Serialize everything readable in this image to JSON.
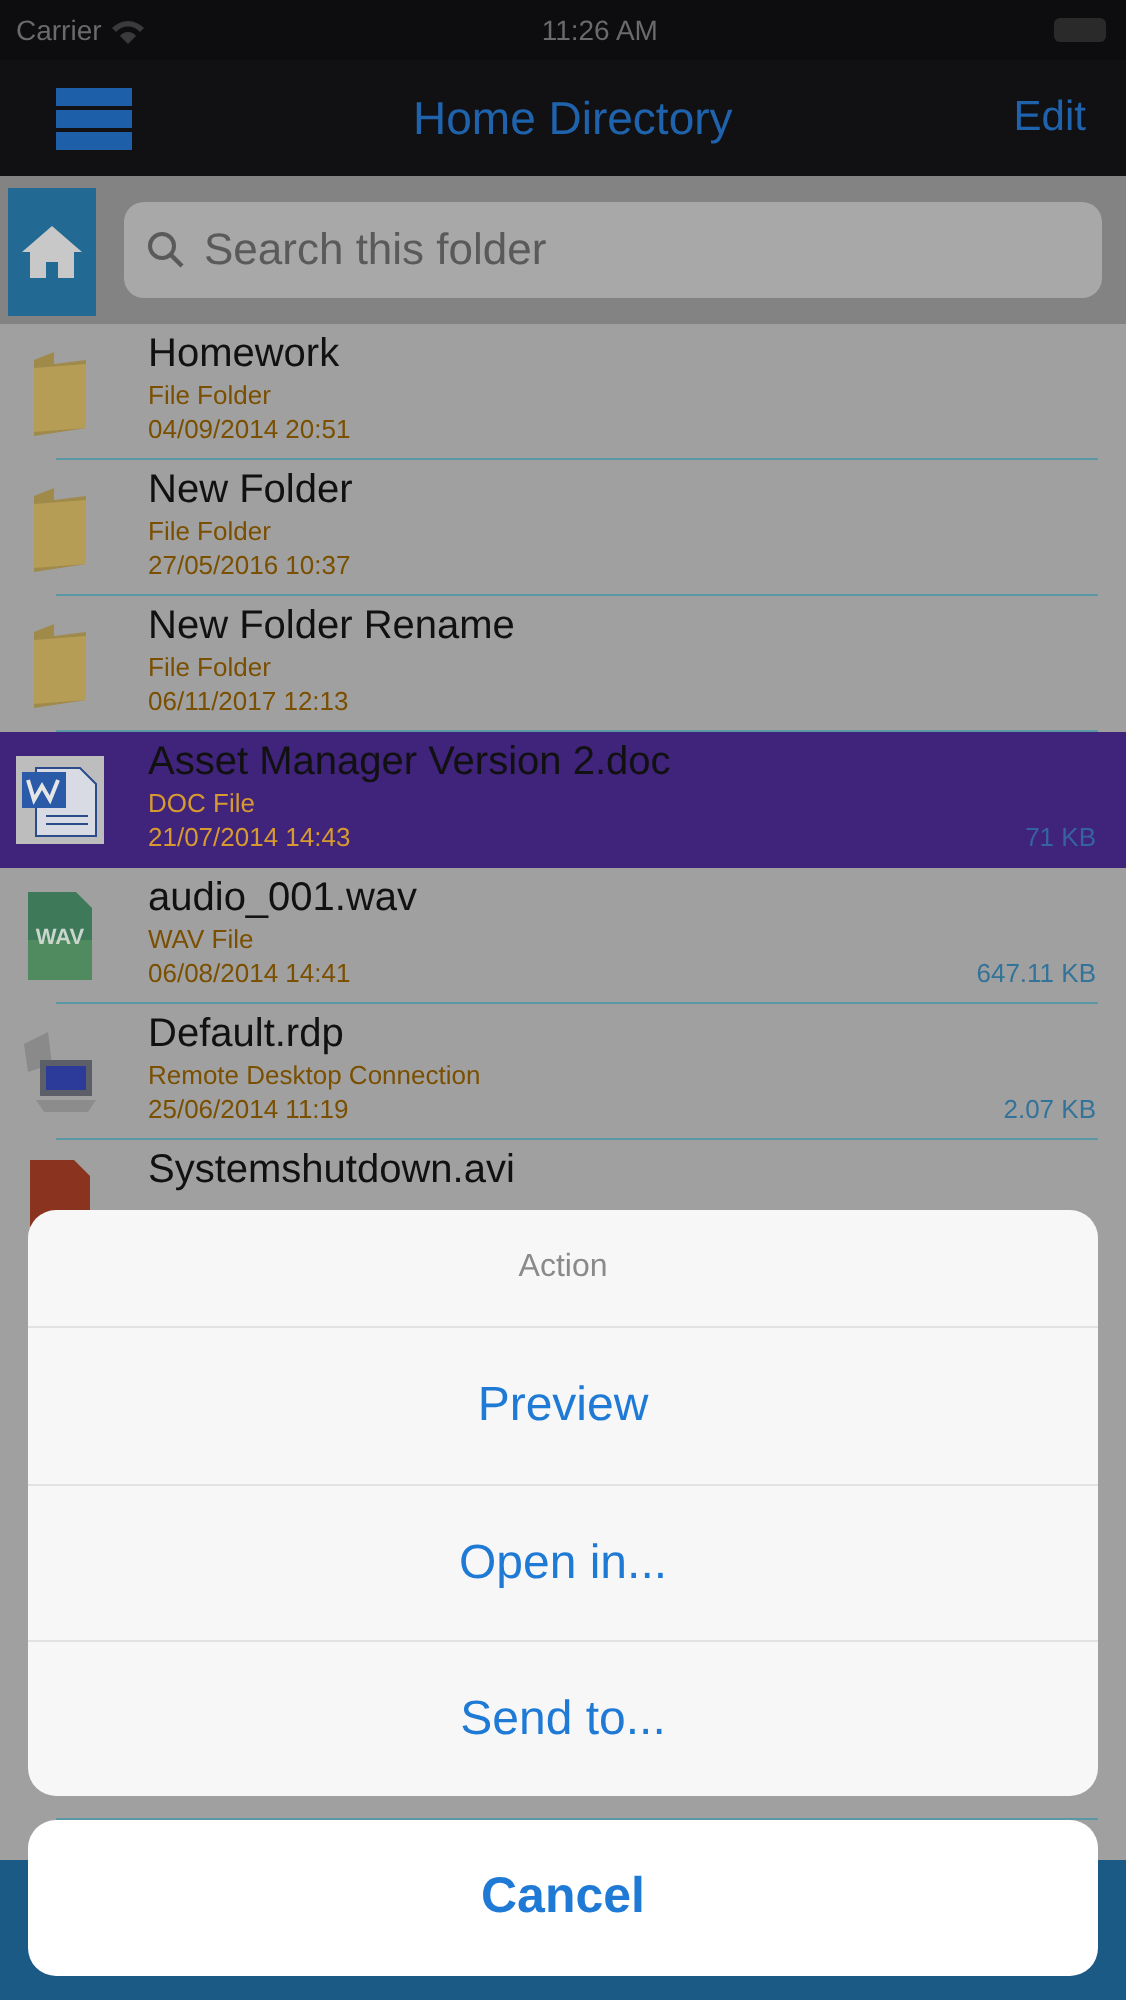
{
  "status_bar": {
    "carrier": "Carrier",
    "time": "11:26 AM"
  },
  "nav": {
    "title": "Home Directory",
    "edit": "Edit"
  },
  "search": {
    "placeholder": "Search this folder"
  },
  "files": [
    {
      "kind": "folder",
      "name": "Homework",
      "type": "File Folder",
      "modified": "04/09/2014 20:51",
      "selected": false
    },
    {
      "kind": "folder",
      "name": "New Folder",
      "type": "File Folder",
      "modified": "27/05/2016 10:37",
      "selected": false
    },
    {
      "kind": "folder",
      "name": "New Folder Rename",
      "type": "File Folder",
      "modified": "06/11/2017 12:13",
      "selected": false
    },
    {
      "kind": "doc",
      "name": "Asset Manager Version 2.doc",
      "type": "DOC File",
      "modified": "21/07/2014 14:43",
      "size": "71 KB",
      "selected": true
    },
    {
      "kind": "wav",
      "icon_label": "WAV",
      "name": "audio_001.wav",
      "type": "WAV File",
      "modified": "06/08/2014 14:41",
      "size": "647.11 KB",
      "selected": false
    },
    {
      "kind": "rdp",
      "name": "Default.rdp",
      "type": "Remote Desktop Connection",
      "modified": "25/06/2014 11:19",
      "size": "2.07 KB",
      "selected": false
    },
    {
      "kind": "avi",
      "name": "Systemshutdown.avi",
      "selected": false
    }
  ],
  "action_sheet": {
    "title": "Action",
    "actions": [
      "Preview",
      "Open in...",
      "Send to..."
    ],
    "cancel": "Cancel"
  }
}
